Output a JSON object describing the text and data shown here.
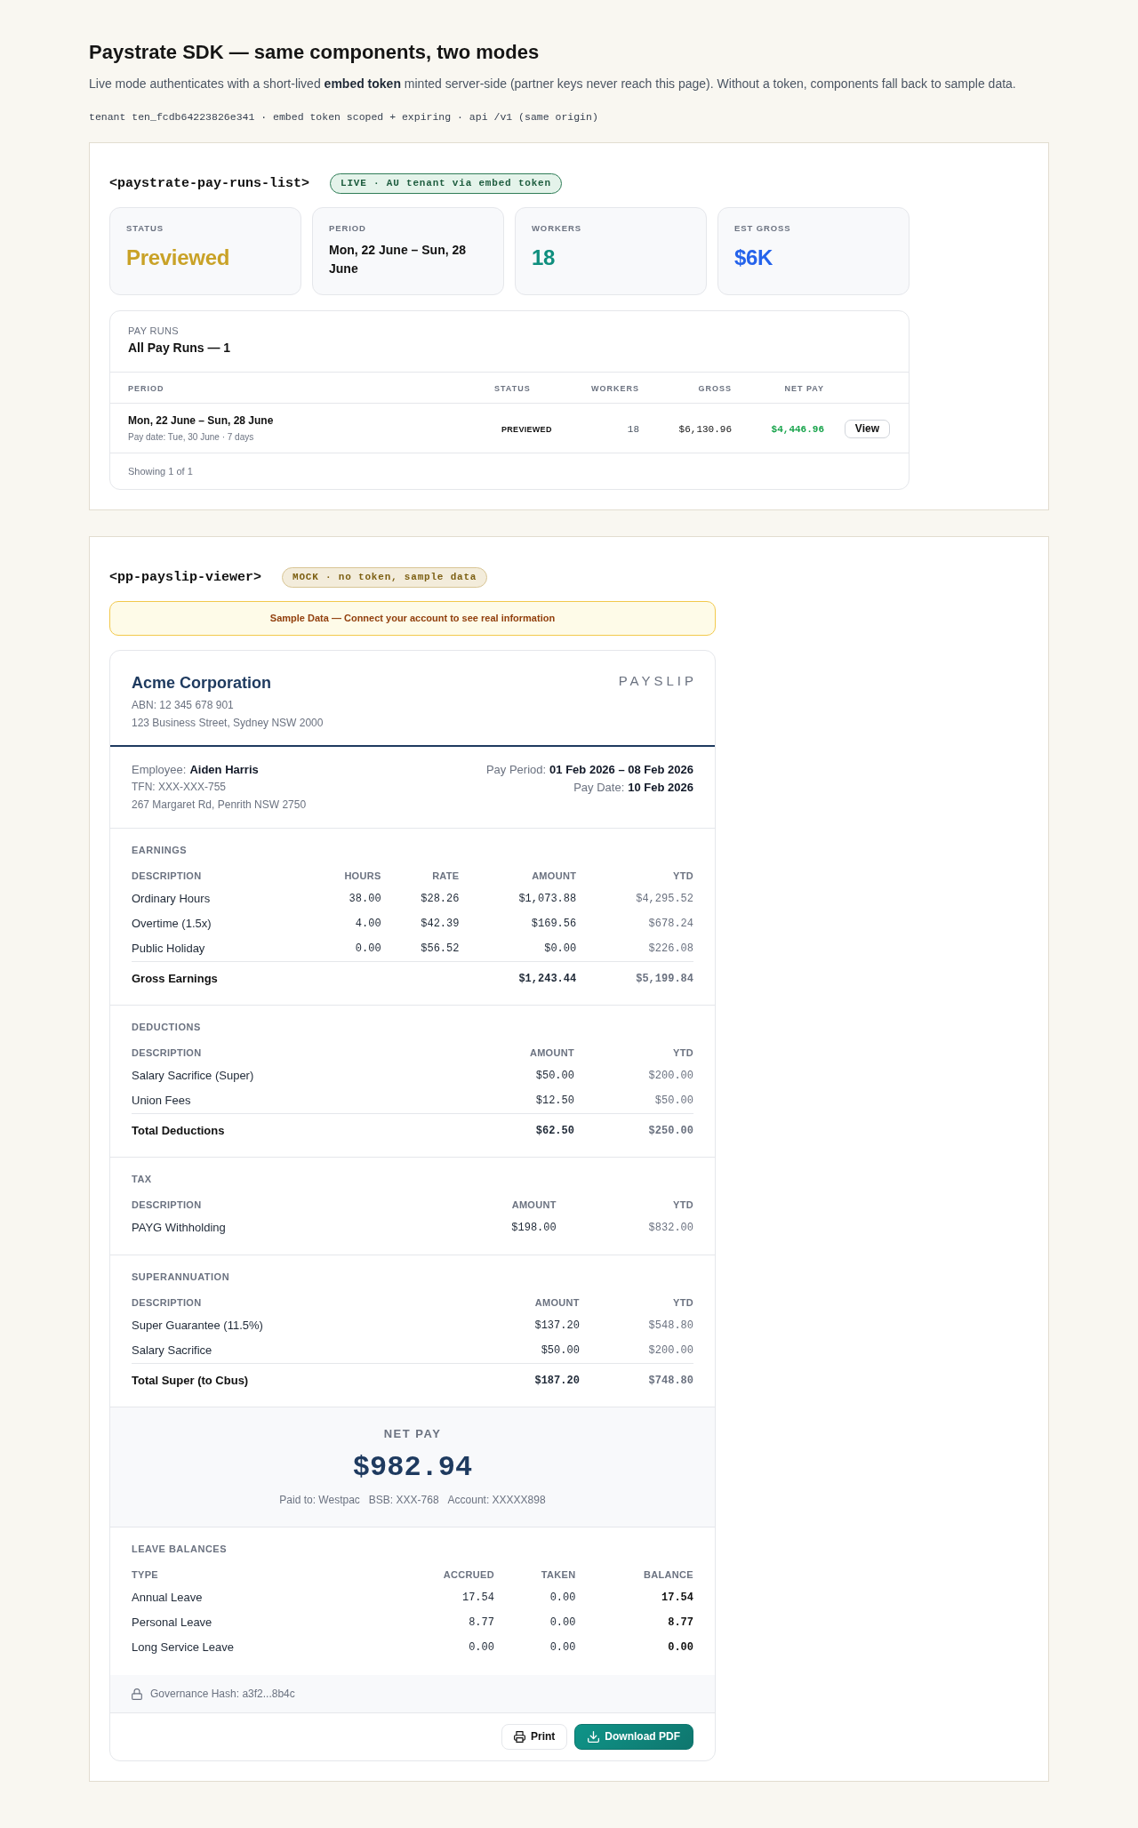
{
  "page": {
    "title": "Paystrate SDK — same components, two modes",
    "intro": "Live mode authenticates with a short-lived **embed token** minted server-side (partner keys never reach this page). Without a token, components fall back to sample data.",
    "meta": "tenant ten_fcdb64223826e341 · embed token scoped + expiring · api /v1 (same origin)"
  },
  "pay_runs_panel": {
    "tag": "<paystrate-pay-runs-list>",
    "badge": {
      "text": "LIVE · AU tenant via embed token",
      "kind": "live"
    },
    "stats": [
      {
        "label": "STATUS",
        "value": "Previewed",
        "kind": "status"
      },
      {
        "label": "PERIOD",
        "value": "Mon, 22 June – Sun, 28 June",
        "kind": "period"
      },
      {
        "label": "WORKERS",
        "value": "18",
        "kind": "count"
      },
      {
        "label": "EST GROSS",
        "value": "$6K",
        "kind": "money"
      }
    ],
    "list": {
      "eyebrow": "PAY RUNS",
      "title": "All Pay Runs — 1",
      "columns": [
        {
          "label": "PERIOD",
          "kind": "period"
        },
        {
          "label": "STATUS",
          "kind": "status"
        },
        {
          "label": "WORKERS",
          "kind": "workers"
        },
        {
          "label": "GROSS",
          "kind": "gross"
        },
        {
          "label": "NET PAY",
          "kind": "net_pay"
        }
      ],
      "rows": [
        {
          "period": "Mon, 22 June – Sun, 28 June",
          "pay_date": "Pay date: Tue, 30 June · 7 days",
          "status": "PREVIEWED",
          "workers": "18",
          "gross": "$6,130.96",
          "net_pay": "$4,446.96",
          "action": "View"
        }
      ],
      "footer": "Showing 1 of 1"
    }
  },
  "payslip_panel": {
    "tag": "<pp-payslip-viewer>",
    "badge": {
      "text": "MOCK · no token, sample data",
      "kind": "mock"
    },
    "notice": "Sample Data — Connect your account to see real information",
    "payslip": {
      "company": "Acme Corporation",
      "abn": "ABN: 12 345 678 901",
      "address": "123 Business Street, Sydney NSW 2000",
      "doc_title": "PAYSLIP",
      "employee": {
        "label": "Employee:",
        "name": "Aiden Harris",
        "tfn": "TFN: XXX-XXX-755",
        "address": "267 Margaret Rd, Penrith NSW 2750"
      },
      "pay_info": [
        {
          "label": "Pay Period:",
          "value": "01 Feb 2026 – 08 Feb 2026"
        },
        {
          "label": "Pay Date:",
          "value": "10 Feb 2026"
        }
      ],
      "sections": [
        {
          "title": "EARNINGS",
          "columns": [
            {
              "label": "DESCRIPTION",
              "kind": "description"
            },
            {
              "label": "HOURS",
              "kind": "hours"
            },
            {
              "label": "RATE",
              "kind": "rate"
            },
            {
              "label": "AMOUNT",
              "kind": "amount"
            },
            {
              "label": "YTD",
              "kind": "ytd"
            }
          ],
          "rows": [
            [
              "Ordinary Hours",
              "38.00",
              "$28.26",
              "$1,073.88",
              "$4,295.52"
            ],
            [
              "Overtime (1.5x)",
              "4.00",
              "$42.39",
              "$169.56",
              "$678.24"
            ],
            [
              "Public Holiday",
              "0.00",
              "$56.52",
              "$0.00",
              "$226.08"
            ]
          ],
          "total": {
            "description": "Gross Earnings",
            "amount": "$1,243.44",
            "ytd": "$5,199.84"
          }
        },
        {
          "title": "DEDUCTIONS",
          "columns": [
            {
              "label": "DESCRIPTION",
              "kind": "description"
            },
            {
              "label": "AMOUNT",
              "kind": "amount"
            },
            {
              "label": "YTD",
              "kind": "ytd"
            }
          ],
          "rows": [
            [
              "Salary Sacrifice (Super)",
              "$50.00",
              "$200.00"
            ],
            [
              "Union Fees",
              "$12.50",
              "$50.00"
            ]
          ],
          "total": {
            "description": "Total Deductions",
            "amount": "$62.50",
            "ytd": "$250.00"
          }
        },
        {
          "title": "TAX",
          "columns": [
            {
              "label": "DESCRIPTION",
              "kind": "description"
            },
            {
              "label": "AMOUNT",
              "kind": "amount"
            },
            {
              "label": "YTD",
              "kind": "ytd"
            }
          ],
          "rows": [
            [
              "PAYG Withholding",
              "$198.00",
              "$832.00"
            ]
          ]
        },
        {
          "title": "SUPERANNUATION",
          "columns": [
            {
              "label": "DESCRIPTION",
              "kind": "description"
            },
            {
              "label": "AMOUNT",
              "kind": "amount"
            },
            {
              "label": "YTD",
              "kind": "ytd"
            }
          ],
          "rows": [
            [
              "Super Guarantee (11.5%)",
              "$137.20",
              "$548.80"
            ],
            [
              "Salary Sacrifice",
              "$50.00",
              "$200.00"
            ]
          ],
          "total": {
            "description": "Total Super (to Cbus)",
            "amount": "$187.20",
            "ytd": "$748.80"
          }
        }
      ],
      "net_pay": {
        "label": "NET PAY",
        "amount": "$982.94",
        "details": [
          "Paid to: Westpac",
          "BSB: XXX-768",
          "Account: XXXXX898"
        ]
      },
      "leave_balances": {
        "title": "LEAVE BALANCES",
        "columns": [
          {
            "label": "TYPE",
            "kind": "type"
          },
          {
            "label": "ACCRUED",
            "kind": "accrued"
          },
          {
            "label": "TAKEN",
            "kind": "taken"
          },
          {
            "label": "BALANCE",
            "kind": "balance"
          }
        ],
        "rows": [
          [
            "Annual Leave",
            "17.54",
            "0.00",
            "17.54"
          ],
          [
            "Personal Leave",
            "8.77",
            "0.00",
            "8.77"
          ],
          [
            "Long Service Leave",
            "0.00",
            "0.00",
            "0.00"
          ]
        ]
      },
      "governance": "Governance Hash: a3f2...8b4c",
      "actions": [
        {
          "label": "Print",
          "kind": "print"
        },
        {
          "label": "Download PDF",
          "kind": "download"
        }
      ]
    }
  }
}
